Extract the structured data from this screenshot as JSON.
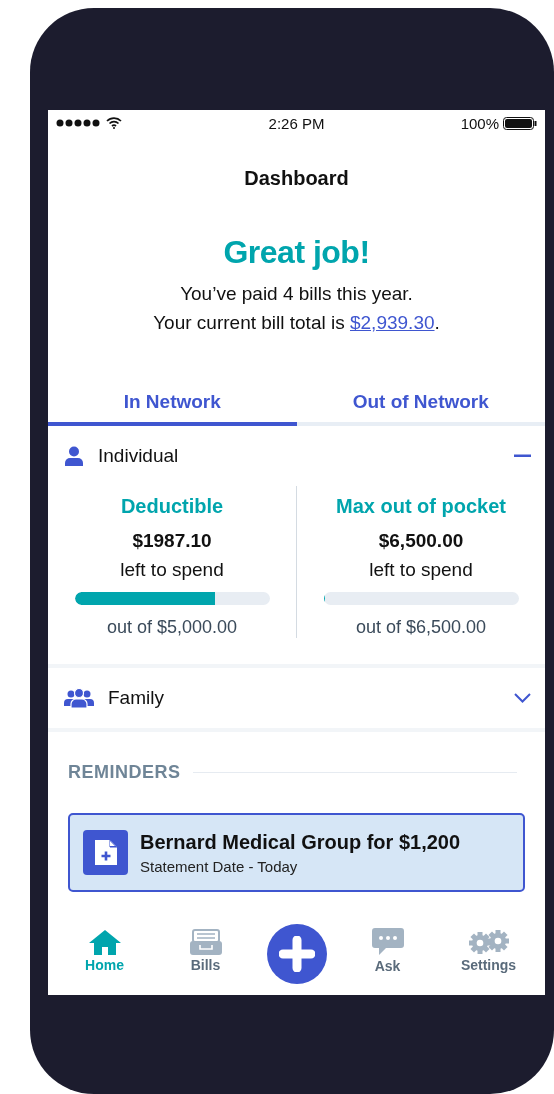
{
  "status_bar": {
    "time": "2:26 PM",
    "battery": "100%"
  },
  "title": "Dashboard",
  "headline": "Great job!",
  "message": {
    "line_1": "You’ve paid 4 bills this year.",
    "line_2_before": "Your current bill total is ",
    "line_2_link": "$2,939.30",
    "line_2_after": "."
  },
  "tabs": [
    {
      "label": "In Network",
      "selected": true
    },
    {
      "label": "Out of Network",
      "selected": false
    }
  ],
  "sections": [
    {
      "label": "Individual",
      "kind": "person",
      "expanded": true,
      "meters": [
        {
          "title": "Deductible",
          "amount": "$1987.10",
          "caption": "left to spend",
          "level": 0.72,
          "total": "out of $5,000.00"
        },
        {
          "title": "Max out of pocket",
          "amount": "$6,500.00",
          "caption": "left to spend",
          "level": 0.01,
          "total": "out of $6,500.00"
        }
      ]
    },
    {
      "label": "Family",
      "kind": "group",
      "expanded": false
    }
  ],
  "reminders": {
    "heading": "REMINDERS",
    "items": [
      {
        "title": "Bernard Medical Group for $1,200",
        "subtitle": "Statement Date - Today"
      }
    ]
  },
  "nav": [
    {
      "label": "Home",
      "kind": "home",
      "selected": true
    },
    {
      "label": "Bills",
      "kind": "bills",
      "selected": false
    },
    {
      "kind": "add"
    },
    {
      "label": "Ask",
      "kind": "ask",
      "selected": false
    },
    {
      "label": "Settings",
      "kind": "settings",
      "selected": false
    }
  ]
}
